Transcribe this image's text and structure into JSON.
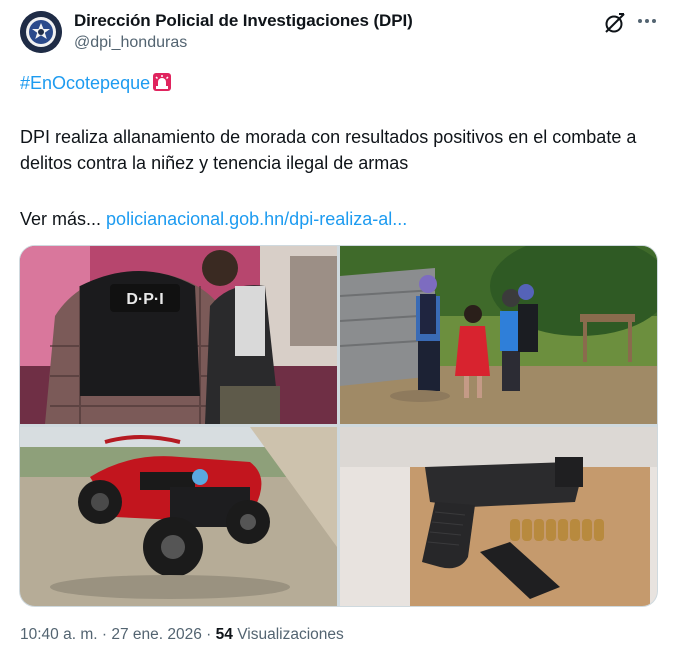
{
  "author": {
    "name": "Dirección Policial de Investigaciones (DPI)",
    "handle": "@dpi_honduras",
    "avatar_icon": "dpi-badge-logo"
  },
  "tweet": {
    "hashtag": "#EnOcotepeque",
    "hashtag_emoji": "rotating-light-icon",
    "body": "DPI realiza allanamiento de morada con resultados positivos en el combate a delitos contra la niñez y tenencia ilegal de armas",
    "more_prefix": "Ver más...",
    "link": "policianacional.gob.hn/dpi-realiza-al..."
  },
  "media": {
    "vest_text": "D·P·I"
  },
  "meta": {
    "time": "10:40 a. m.",
    "separator": "·",
    "date": "27 ene. 2026",
    "views_count": "54",
    "views_label": "Visualizaciones"
  },
  "colors": {
    "link": "#1d9bf0",
    "secondary_text": "#536471",
    "primary_text": "#0f1419",
    "border": "#cfd9de"
  }
}
